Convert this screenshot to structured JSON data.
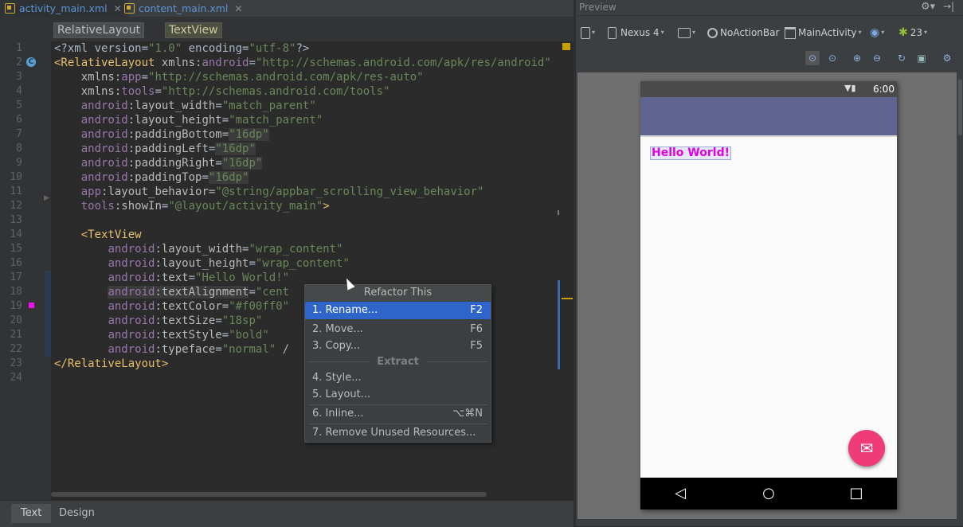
{
  "tabs": [
    {
      "label": "activity_main.xml",
      "active": true
    },
    {
      "label": "content_main.xml",
      "active": false
    }
  ],
  "breadcrumb": [
    "RelativeLayout",
    "TextView"
  ],
  "line_numbers": [
    "1",
    "2",
    "3",
    "4",
    "5",
    "6",
    "7",
    "8",
    "9",
    "10",
    "11",
    "12",
    "13",
    "14",
    "15",
    "16",
    "17",
    "18",
    "19",
    "20",
    "21",
    "22",
    "23",
    "24"
  ],
  "code_lines": [
    [
      {
        "c": "t-plain",
        "t": "<?xml version="
      },
      {
        "c": "t-val",
        "t": "\"1.0\""
      },
      {
        "c": "t-plain",
        "t": " encoding="
      },
      {
        "c": "t-val",
        "t": "\"utf-8\""
      },
      {
        "c": "t-plain",
        "t": "?>"
      }
    ],
    [
      {
        "c": "t-tag",
        "t": "<RelativeLayout"
      },
      {
        "c": "t-plain",
        "t": " "
      },
      {
        "c": "t-attr",
        "t": "xmlns:"
      },
      {
        "c": "t-ns",
        "t": "android"
      },
      {
        "c": "t-plain",
        "t": "="
      },
      {
        "c": "t-val",
        "t": "\"http://schemas.android.com/apk/res/android\""
      }
    ],
    [
      {
        "c": "t-plain",
        "t": "    "
      },
      {
        "c": "t-attr",
        "t": "xmlns:"
      },
      {
        "c": "t-ns",
        "t": "app"
      },
      {
        "c": "t-plain",
        "t": "="
      },
      {
        "c": "t-val",
        "t": "\"http://schemas.android.com/apk/res-auto\""
      }
    ],
    [
      {
        "c": "t-plain",
        "t": "    "
      },
      {
        "c": "t-attr",
        "t": "xmlns:"
      },
      {
        "c": "t-ns",
        "t": "tools"
      },
      {
        "c": "t-plain",
        "t": "="
      },
      {
        "c": "t-val",
        "t": "\"http://schemas.android.com/tools\""
      }
    ],
    [
      {
        "c": "t-plain",
        "t": "    "
      },
      {
        "c": "t-ns",
        "t": "android"
      },
      {
        "c": "t-attr",
        "t": ":layout_width"
      },
      {
        "c": "t-plain",
        "t": "="
      },
      {
        "c": "t-val",
        "t": "\"match_parent\""
      }
    ],
    [
      {
        "c": "t-plain",
        "t": "    "
      },
      {
        "c": "t-ns",
        "t": "android"
      },
      {
        "c": "t-attr",
        "t": ":layout_height"
      },
      {
        "c": "t-plain",
        "t": "="
      },
      {
        "c": "t-val",
        "t": "\"match_parent\""
      }
    ],
    [
      {
        "c": "t-plain",
        "t": "    "
      },
      {
        "c": "t-ns",
        "t": "android"
      },
      {
        "c": "t-attr",
        "t": ":paddingBottom"
      },
      {
        "c": "t-plain",
        "t": "="
      },
      {
        "c": "t-val t-hl",
        "t": "\"16dp\""
      }
    ],
    [
      {
        "c": "t-plain",
        "t": "    "
      },
      {
        "c": "t-ns",
        "t": "android"
      },
      {
        "c": "t-attr",
        "t": ":paddingLeft"
      },
      {
        "c": "t-plain",
        "t": "="
      },
      {
        "c": "t-val t-hl",
        "t": "\"16dp\""
      }
    ],
    [
      {
        "c": "t-plain",
        "t": "    "
      },
      {
        "c": "t-ns",
        "t": "android"
      },
      {
        "c": "t-attr",
        "t": ":paddingRight"
      },
      {
        "c": "t-plain",
        "t": "="
      },
      {
        "c": "t-val t-hl",
        "t": "\"16dp\""
      }
    ],
    [
      {
        "c": "t-plain",
        "t": "    "
      },
      {
        "c": "t-ns",
        "t": "android"
      },
      {
        "c": "t-attr",
        "t": ":paddingTop"
      },
      {
        "c": "t-plain",
        "t": "="
      },
      {
        "c": "t-val t-hl",
        "t": "\"16dp\""
      }
    ],
    [
      {
        "c": "t-plain",
        "t": "    "
      },
      {
        "c": "t-ns",
        "t": "app"
      },
      {
        "c": "t-attr",
        "t": ":layout_behavior"
      },
      {
        "c": "t-plain",
        "t": "="
      },
      {
        "c": "t-val",
        "t": "\"@string/appbar_scrolling_view_behavior\""
      }
    ],
    [
      {
        "c": "t-plain",
        "t": "    "
      },
      {
        "c": "t-ns",
        "t": "tools"
      },
      {
        "c": "t-attr",
        "t": ":showIn"
      },
      {
        "c": "t-plain",
        "t": "="
      },
      {
        "c": "t-val",
        "t": "\"@layout/activity_main\""
      },
      {
        "c": "t-tag",
        "t": ">"
      }
    ],
    [
      {
        "c": "t-plain",
        "t": ""
      }
    ],
    [
      {
        "c": "t-plain",
        "t": "    "
      },
      {
        "c": "t-tag",
        "t": "<TextView"
      }
    ],
    [
      {
        "c": "t-plain",
        "t": "        "
      },
      {
        "c": "t-ns",
        "t": "android"
      },
      {
        "c": "t-attr",
        "t": ":layout_width"
      },
      {
        "c": "t-plain",
        "t": "="
      },
      {
        "c": "t-val",
        "t": "\"wrap_content\""
      }
    ],
    [
      {
        "c": "t-plain",
        "t": "        "
      },
      {
        "c": "t-ns",
        "t": "android"
      },
      {
        "c": "t-attr",
        "t": ":layout_height"
      },
      {
        "c": "t-plain",
        "t": "="
      },
      {
        "c": "t-val",
        "t": "\"wrap_content\""
      }
    ],
    [
      {
        "c": "t-plain",
        "t": "        "
      },
      {
        "c": "t-ns",
        "t": "android"
      },
      {
        "c": "t-attr",
        "t": ":text"
      },
      {
        "c": "t-plain",
        "t": "="
      },
      {
        "c": "t-val",
        "t": "\"Hello World!\""
      }
    ],
    [
      {
        "c": "t-plain",
        "t": "        "
      },
      {
        "c": "t-ns t-hl",
        "t": "android"
      },
      {
        "c": "t-attr t-hl",
        "t": ":textAlignment"
      },
      {
        "c": "t-plain",
        "t": "="
      },
      {
        "c": "t-val",
        "t": "\"cent"
      }
    ],
    [
      {
        "c": "t-plain",
        "t": "        "
      },
      {
        "c": "t-ns",
        "t": "android"
      },
      {
        "c": "t-attr",
        "t": ":textColor"
      },
      {
        "c": "t-plain",
        "t": "="
      },
      {
        "c": "t-val",
        "t": "\"#f00ff0\""
      }
    ],
    [
      {
        "c": "t-plain",
        "t": "        "
      },
      {
        "c": "t-ns",
        "t": "android"
      },
      {
        "c": "t-attr",
        "t": ":textSize"
      },
      {
        "c": "t-plain",
        "t": "="
      },
      {
        "c": "t-val",
        "t": "\"18sp\""
      }
    ],
    [
      {
        "c": "t-plain",
        "t": "        "
      },
      {
        "c": "t-ns",
        "t": "android"
      },
      {
        "c": "t-attr",
        "t": ":textStyle"
      },
      {
        "c": "t-plain",
        "t": "="
      },
      {
        "c": "t-val",
        "t": "\"bold\""
      }
    ],
    [
      {
        "c": "t-plain",
        "t": "        "
      },
      {
        "c": "t-ns",
        "t": "android"
      },
      {
        "c": "t-attr",
        "t": ":typeface"
      },
      {
        "c": "t-plain",
        "t": "="
      },
      {
        "c": "t-val",
        "t": "\"normal\""
      },
      {
        "c": "t-plain",
        "t": " /"
      }
    ],
    [
      {
        "c": "t-tag",
        "t": "</RelativeLayout>"
      }
    ],
    [
      {
        "c": "t-plain",
        "t": ""
      }
    ]
  ],
  "bottom_tabs": [
    {
      "label": "Text",
      "selected": true
    },
    {
      "label": "Design",
      "selected": false
    }
  ],
  "preview": {
    "title": "Preview",
    "device": "Nexus 4",
    "theme": "NoActionBar",
    "activity": "MainActivity",
    "api": "23",
    "status_time": "6:00",
    "hello_text": "Hello World!",
    "text_color": "#f00ff0"
  },
  "context_menu": {
    "title": "Refactor This",
    "group_extract": "Extract",
    "items": [
      {
        "label": "1. Rename...",
        "shortcut": "F2",
        "selected": true
      },
      {
        "label": "2. Move...",
        "shortcut": "F6",
        "selected": false
      },
      {
        "label": "3. Copy...",
        "shortcut": "F5",
        "selected": false
      },
      {
        "label": "4. Style...",
        "shortcut": "",
        "selected": false
      },
      {
        "label": "5. Layout...",
        "shortcut": "",
        "selected": false
      },
      {
        "label": "6. Inline...",
        "shortcut": "⌥⌘N",
        "selected": false
      },
      {
        "label": "7. Remove Unused Resources...",
        "shortcut": "",
        "selected": false
      }
    ]
  },
  "colors": {
    "editor_bg": "#2b2b2b",
    "selection": "#2f65ca",
    "appbar": "#5e6390",
    "fab": "#ef3b77"
  }
}
